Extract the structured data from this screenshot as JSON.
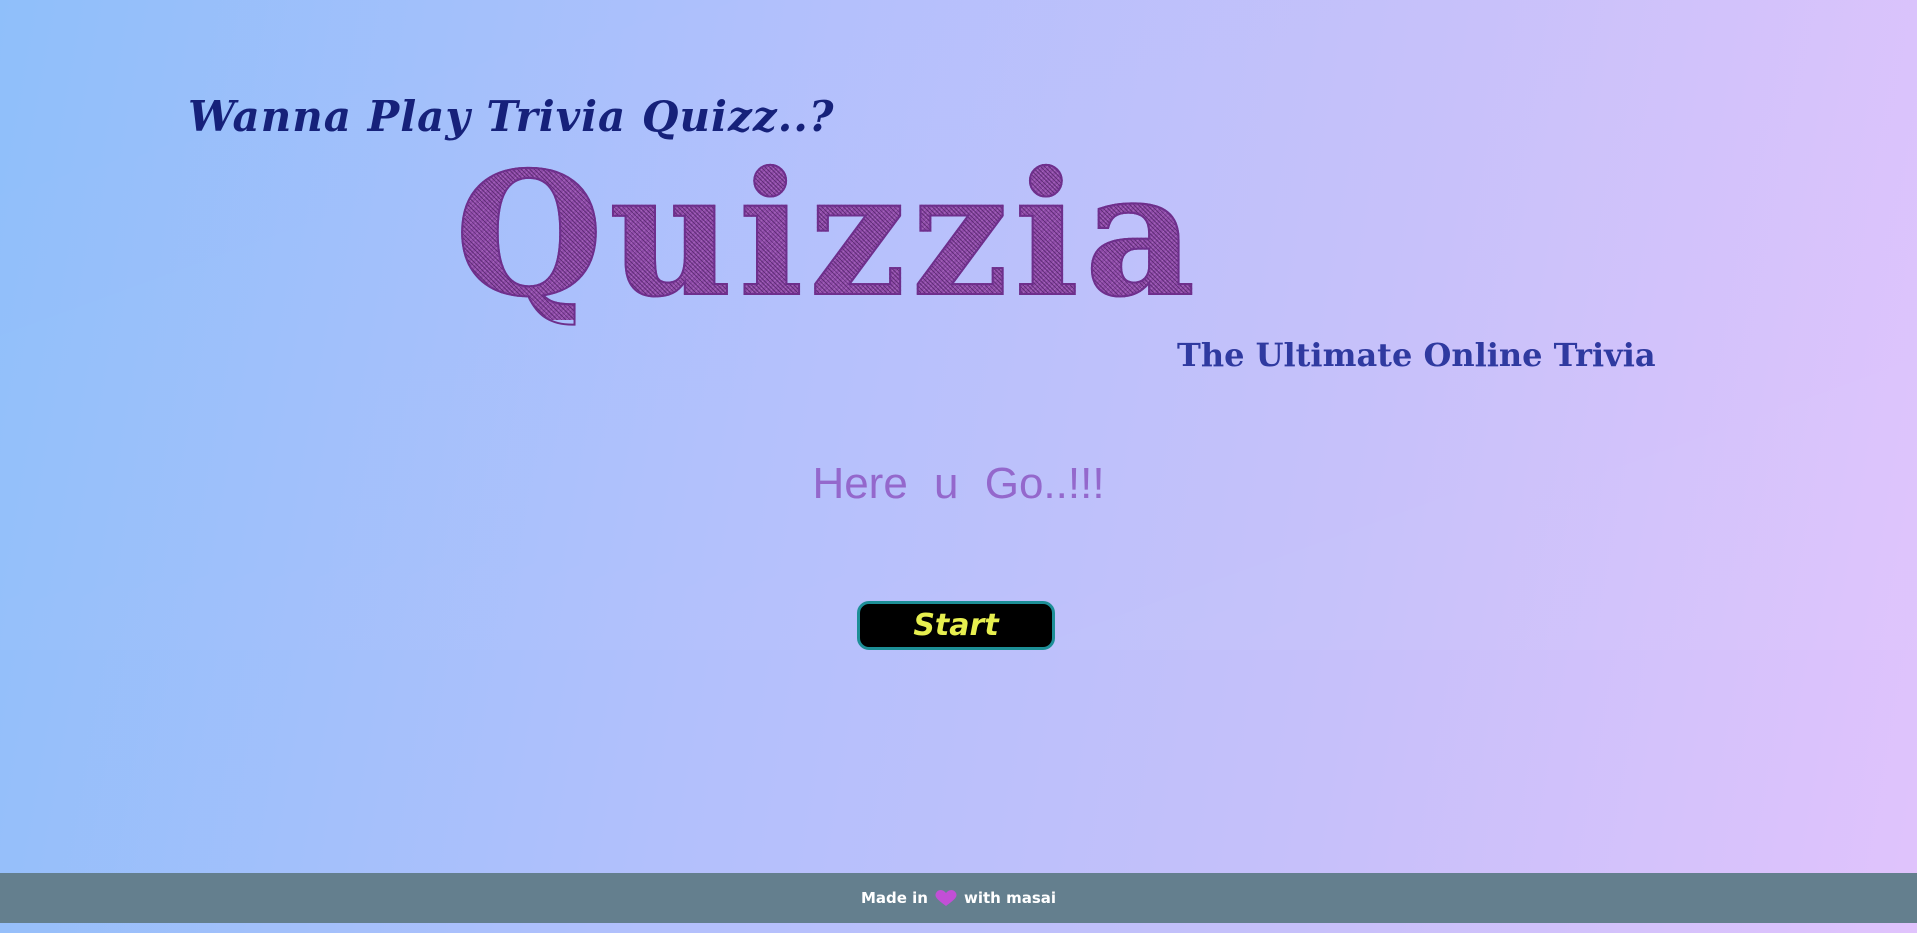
{
  "header": {
    "tagline": "Wanna Play Trivia Quizz..?",
    "brand": "Quizzia",
    "subtitle": "The Ultimate Online Trivia"
  },
  "main": {
    "prompt": "Here  u  Go..!!!",
    "start_label": "Start"
  },
  "footer": {
    "prefix": "Made in",
    "suffix": "with masai",
    "heart_icon": "heart-icon"
  },
  "colors": {
    "tagline": "#16217a",
    "brand": "#8a4aa8",
    "subtitle": "#2f3aa0",
    "prompt": "#9468cc",
    "button_bg": "#000000",
    "button_text": "#e7ef4f",
    "button_border": "#1d8f97",
    "footer_bg": "#647f8e",
    "heart": "#c24fd6"
  }
}
